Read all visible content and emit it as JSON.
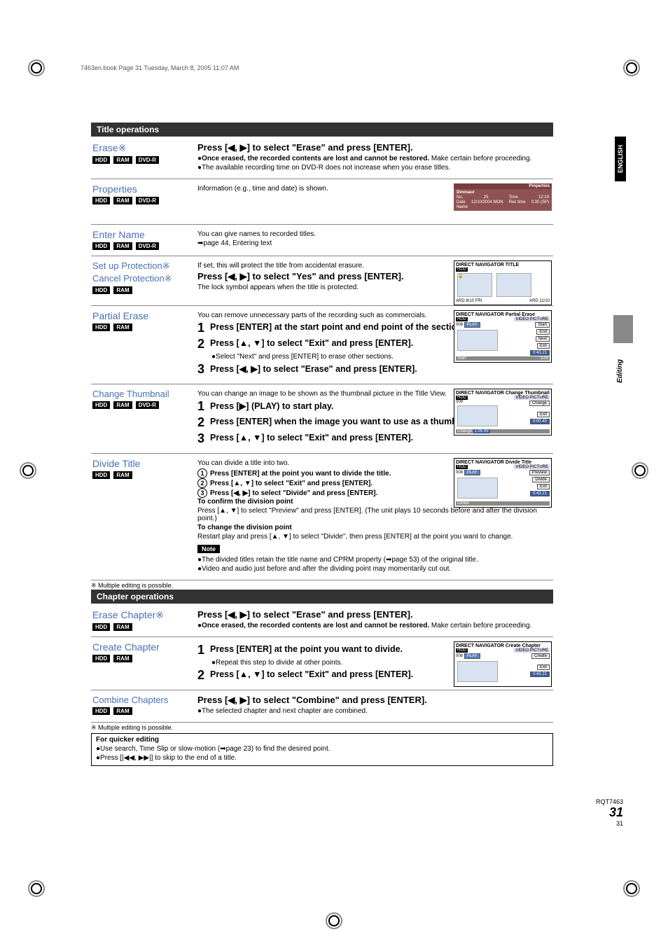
{
  "print_marks": {
    "header_line": "7463en.book  Page 31  Tuesday, March 8, 2005  11:07 AM"
  },
  "side_tabs": {
    "english": "ENGLISH",
    "editing": "Editing"
  },
  "title_ops_header": "Title operations",
  "erase": {
    "title": "Erase※",
    "badges": [
      "HDD",
      "RAM",
      "DVD-R"
    ],
    "instr": "Press [◀, ▶] to select \"Erase\" and press [ENTER].",
    "bullet1": "●Once erased, the recorded contents are lost and cannot be restored.",
    "bullet1_tail": " Make certain before proceeding.",
    "bullet2": "●The available recording time on DVD-R does not increase when you erase titles."
  },
  "properties": {
    "title": "Properties",
    "badges": [
      "HDD",
      "RAM",
      "DVD-R"
    ],
    "text": "Information (e.g., time and date) is shown.",
    "mini": {
      "title": "Properties",
      "name": "Dinosaur",
      "no_label": "No.",
      "no_val": "25",
      "date_label": "Date",
      "date_val": "12/10/2004 MON",
      "time_label": "Time",
      "time_val": "12:19",
      "rec_label": "Rec time",
      "rec_val": "0:30 (SP)",
      "name_label": "Name"
    }
  },
  "enter_name": {
    "title": "Enter Name",
    "badges": [
      "HDD",
      "RAM",
      "DVD-R"
    ],
    "text": "You can give names to recorded titles.",
    "ref": "➡page 44, Entering text"
  },
  "protection": {
    "title1": "Set up Protection※",
    "title2": "Cancel Protection※",
    "badges": [
      "HDD",
      "RAM"
    ],
    "text": "If set, this will protect the title from accidental erasure.",
    "instr": "Press [◀, ▶] to select \"Yes\" and press [ENTER].",
    "note": "The lock symbol appears when the title is protected.",
    "mini_title": "DIRECT NAVIGATOR    TITLE",
    "mini_hdd": "HDD",
    "mini_dates": [
      "ARD 8/10 FRI",
      "ARD 11/10"
    ]
  },
  "partial_erase": {
    "title": "Partial Erase",
    "badges": [
      "HDD",
      "RAM"
    ],
    "intro": "You can remove unnecessary parts of the recording such as commercials.",
    "step1": "Press [ENTER] at the start point and end point of the section you want to erase.",
    "step2": "Press [▲, ▼] to select \"Exit\" and press [ENTER].",
    "step2_note": "●Select \"Next\" and press [ENTER] to erase other sections.",
    "step3": "Press [◀, ▶] to select \"Erase\" and press [ENTER].",
    "mini": {
      "title": "DIRECT NAVIGATOR   Partial Erase",
      "hdd": "HDD",
      "tab": "VIDEO PICTURE",
      "track": "008",
      "play": "PLAY",
      "btns": [
        "Start",
        "End",
        "Next",
        "Exit"
      ],
      "time": "0:43.21",
      "bar_l": "Start",
      "bar_r": "End"
    }
  },
  "change_thumb": {
    "title": "Change Thumbnail",
    "badges": [
      "HDD",
      "RAM",
      "DVD-R"
    ],
    "intro": "You can change an image to be shown as the thumbnail picture in the Title View.",
    "step1": "Press [▶] (PLAY) to start play.",
    "step2": "Press [ENTER] when the image you want to use as a thumbnail is shown.",
    "step3": "Press [▲, ▼] to select \"Exit\" and press [ENTER].",
    "mini": {
      "title": "DIRECT NAVIGATOR   Change Thumbnail",
      "hdd": "HDD",
      "tab": "VIDEO PICTURE",
      "track": "008",
      "btns": [
        "Change",
        "Exit"
      ],
      "time": "0:00.45",
      "change_time": "1:05.43",
      "change_label": "Change"
    }
  },
  "divide": {
    "title": "Divide Title",
    "badges": [
      "HDD",
      "RAM"
    ],
    "intro": "You can divide a title into two.",
    "c1": "Press [ENTER] at the point you want to divide the title.",
    "c2": "Press [▲, ▼] to select \"Exit\" and press [ENTER].",
    "c3": "Press [◀, ▶] to select \"Divide\" and press [ENTER].",
    "confirm_h": "To confirm the division point",
    "confirm": "Press [▲, ▼] to select \"Preview\" and press [ENTER]. (The unit plays 10 seconds before and after the division point.)",
    "change_h": "To change the division point",
    "change": "Restart play and press [▲, ▼] to select \"Divide\", then press [ENTER] at the point you want to change.",
    "note1": "●The divided titles retain the title name and CPRM property (➡page 53) of the original title.",
    "note2": "●Video and audio just before and after the dividing point may momentarily cut out.",
    "mini": {
      "title": "DIRECT NAVIGATOR   Divide Title",
      "hdd": "HDD",
      "tab": "VIDEO PICTURE",
      "track": "008",
      "play": "PLAY",
      "btns": [
        "Preview",
        "Divide",
        "Exit"
      ],
      "time": "0:43.21",
      "bar": "Divide"
    }
  },
  "multiple_note": "※ Multiple editing is possible.",
  "chapter_ops_header": "Chapter operations",
  "erase_chapter": {
    "title": "Erase Chapter※",
    "badges": [
      "HDD",
      "RAM"
    ],
    "instr": "Press [◀, ▶] to select \"Erase\" and press [ENTER].",
    "bullet": "●Once erased, the recorded contents are lost and cannot be restored.",
    "bullet_tail": " Make certain before proceeding."
  },
  "create_chapter": {
    "title": "Create Chapter",
    "badges": [
      "HDD",
      "RAM"
    ],
    "step1": "Press [ENTER] at the point you want to divide.",
    "step1_note": "●Repeat this step to divide at other points.",
    "step2": "Press [▲, ▼] to select \"Exit\" and press [ENTER].",
    "mini": {
      "title": "DIRECT NAVIGATOR   Create Chapter",
      "hdd": "HDD",
      "tab": "VIDEO PICTURE",
      "track": "008",
      "play": "PLAY",
      "btns": [
        "Create",
        "Exit"
      ],
      "time": "0:43.21"
    }
  },
  "combine": {
    "title": "Combine Chapters",
    "badges": [
      "HDD",
      "RAM"
    ],
    "instr": "Press [◀, ▶] to select \"Combine\" and press [ENTER].",
    "note": "●The selected chapter and next chapter are combined."
  },
  "quick_edit": {
    "h": "For quicker editing",
    "l1": "●Use search, Time Slip or slow-motion (➡page 23) to find the desired point.",
    "l2": "●Press [|◀◀, ▶▶|] to skip to the end of a title."
  },
  "footer": {
    "code": "RQT7463",
    "big": "31",
    "small": "31"
  }
}
